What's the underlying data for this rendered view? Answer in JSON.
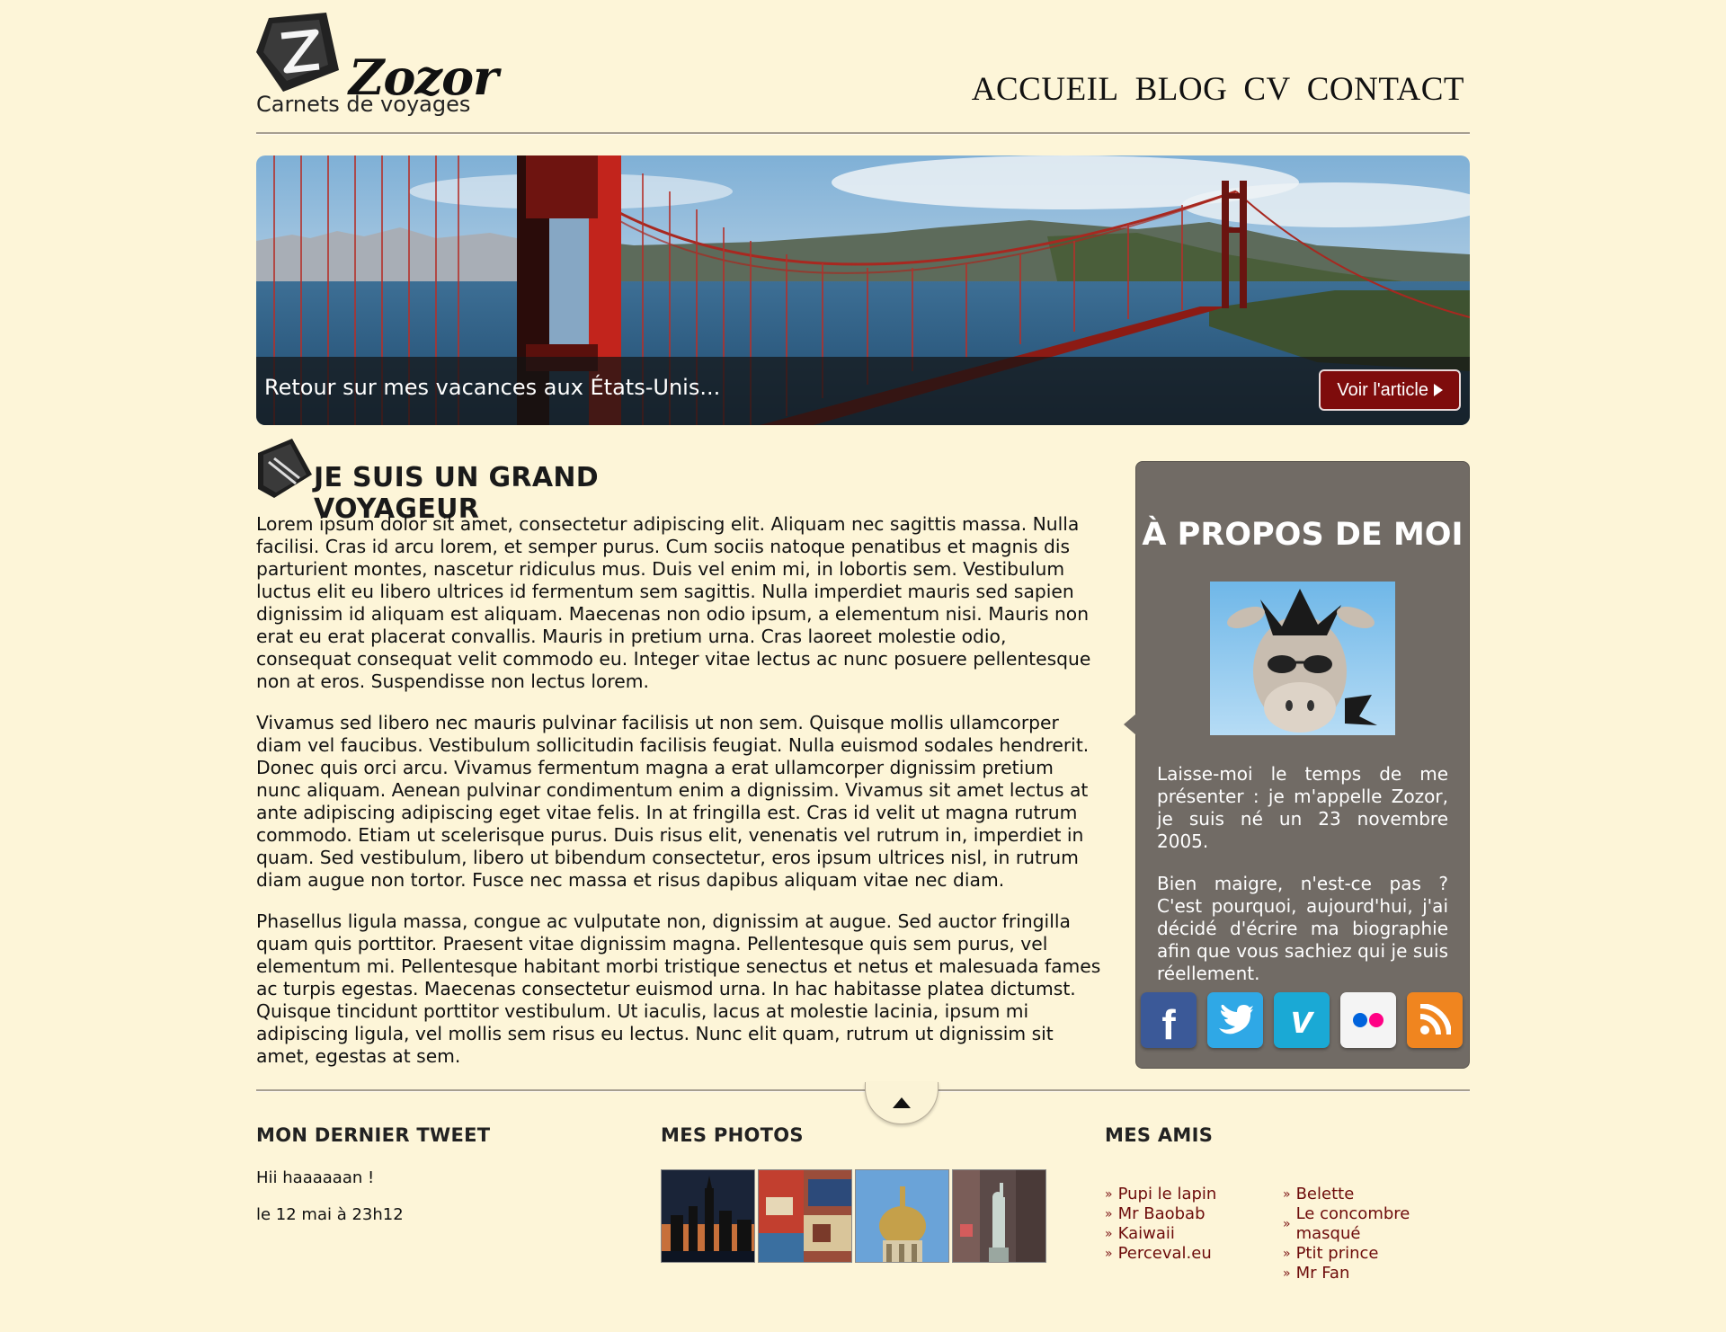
{
  "header": {
    "logo_name": "Zozor",
    "tagline": "Carnets de voyages",
    "nav": [
      "ACCUEIL",
      "BLOG",
      "CV",
      "CONTACT"
    ]
  },
  "banner": {
    "caption": "Retour sur mes vacances aux États-Unis...",
    "button_label": "Voir l'article"
  },
  "article": {
    "title": "JE SUIS UN GRAND VOYAGEUR",
    "paragraphs": [
      "Lorem ipsum dolor sit amet, consectetur adipiscing elit. Aliquam nec sagittis massa. Nulla facilisi. Cras id arcu lorem, et semper purus. Cum sociis natoque penatibus et magnis dis parturient montes, nascetur ridiculus mus. Duis vel enim mi, in lobortis sem. Vestibulum luctus elit eu libero ultrices id fermentum sem sagittis. Nulla imperdiet mauris sed sapien dignissim id aliquam est aliquam. Maecenas non odio ipsum, a elementum nisi. Mauris non erat eu erat placerat convallis. Mauris in pretium urna. Cras laoreet molestie odio, consequat consequat velit commodo eu. Integer vitae lectus ac nunc posuere pellentesque non at eros. Suspendisse non lectus lorem.",
      "Vivamus sed libero nec mauris pulvinar facilisis ut non sem. Quisque mollis ullamcorper diam vel faucibus. Vestibulum sollicitudin facilisis feugiat. Nulla euismod sodales hendrerit. Donec quis orci arcu. Vivamus fermentum magna a erat ullamcorper dignissim pretium nunc aliquam. Aenean pulvinar condimentum enim a dignissim. Vivamus sit amet lectus at ante adipiscing adipiscing eget vitae felis. In at fringilla est. Cras id velit ut magna rutrum commodo. Etiam ut scelerisque purus. Duis risus elit, venenatis vel rutrum in, imperdiet in quam. Sed vestibulum, libero ut bibendum consectetur, eros ipsum ultrices nisl, in rutrum diam augue non tortor. Fusce nec massa et risus dapibus aliquam vitae nec diam.",
      "Phasellus ligula massa, congue ac vulputate non, dignissim at augue. Sed auctor fringilla quam quis porttitor. Praesent vitae dignissim magna. Pellentesque quis sem purus, vel elementum mi. Pellentesque habitant morbi tristique senectus et netus et malesuada fames ac turpis egestas. Maecenas consectetur euismod urna. In hac habitasse platea dictumst. Quisque tincidunt porttitor vestibulum. Ut iaculis, lacus at molestie lacinia, ipsum mi adipiscing ligula, vel mollis sem risus eu lectus. Nunc elit quam, rutrum ut dignissim sit amet, egestas at sem."
    ]
  },
  "about": {
    "title": "À PROPOS DE MOI",
    "paragraphs": [
      "Laisse-moi le temps de me présenter : je m'appelle Zozor, je suis né un 23 novembre 2005.",
      "Bien maigre, n'est-ce pas ? C'est pourquoi, aujourd'hui, j'ai décidé d'écrire ma biographie afin que vous sachiez qui je suis réellement."
    ],
    "socials": [
      {
        "icon": "facebook-icon",
        "color": "#3b5998"
      },
      {
        "icon": "twitter-icon",
        "color": "#2fa8e6"
      },
      {
        "icon": "vimeo-icon",
        "color": "#1aa9d5"
      },
      {
        "icon": "flickr-icon",
        "color": "#f4f4f4"
      },
      {
        "icon": "rss-icon",
        "color": "#f0851f"
      }
    ]
  },
  "footer": {
    "tweet": {
      "heading": "MON DERNIER TWEET",
      "text": "Hii haaaaaan !",
      "date": "le 12 mai à 23h12"
    },
    "photos": {
      "heading": "MES PHOTOS"
    },
    "friends": {
      "heading": "MES AMIS",
      "col1": [
        "Pupi le lapin",
        "Mr Baobab",
        "Kaiwaii",
        "Perceval.eu"
      ],
      "col2": [
        "Belette",
        "Le concombre masqué",
        "Ptit prince",
        "Mr Fan"
      ]
    }
  },
  "colors": {
    "background": "#fdf5d8",
    "about_box": "#716b65",
    "button": "#7e0c0c",
    "link": "#6d0b0b"
  }
}
